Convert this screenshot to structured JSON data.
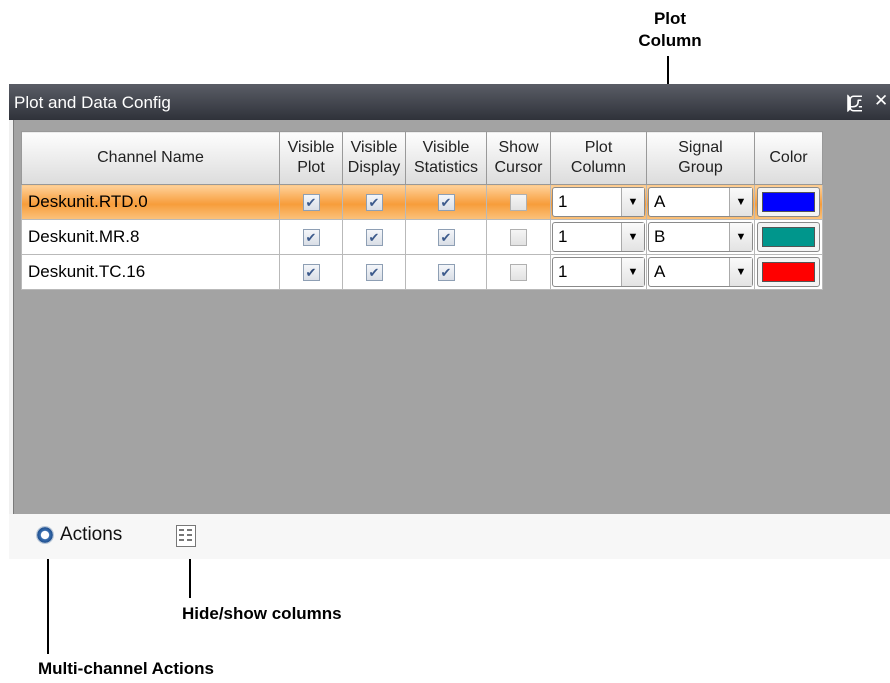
{
  "annotations": {
    "plot_column_line1": "Plot",
    "plot_column_line2": "Column",
    "hide_show": "Hide/show columns",
    "multi_channel": "Multi-channel Actions"
  },
  "window": {
    "title": "Plot and Data Config",
    "pin_icon": "pin-icon",
    "close_icon": "close-icon"
  },
  "table": {
    "headers": [
      {
        "line1": "Channel Name",
        "line2": ""
      },
      {
        "line1": "Visible",
        "line2": "Plot"
      },
      {
        "line1": "Visible",
        "line2": "Display"
      },
      {
        "line1": "Visible",
        "line2": "Statistics"
      },
      {
        "line1": "Show",
        "line2": "Cursor"
      },
      {
        "line1": "Plot",
        "line2": "Column"
      },
      {
        "line1": "Signal",
        "line2": "Group"
      },
      {
        "line1": "Color",
        "line2": ""
      }
    ],
    "rows": [
      {
        "name": "Deskunit.RTD.0",
        "visible_plot": true,
        "visible_display": true,
        "visible_statistics": true,
        "show_cursor": false,
        "plot_column": "1",
        "signal_group": "A",
        "color": "#0000ff",
        "selected": true
      },
      {
        "name": "Deskunit.MR.8",
        "visible_plot": true,
        "visible_display": true,
        "visible_statistics": true,
        "show_cursor": false,
        "plot_column": "1",
        "signal_group": "B",
        "color": "#00968c",
        "selected": false
      },
      {
        "name": "Deskunit.TC.16",
        "visible_plot": true,
        "visible_display": true,
        "visible_statistics": true,
        "show_cursor": false,
        "plot_column": "1",
        "signal_group": "A",
        "color": "#ff0000",
        "selected": false
      }
    ]
  },
  "toolbar": {
    "actions_label": "Actions",
    "actions_icon": "gear-icon",
    "columns_icon": "columns-icon"
  }
}
